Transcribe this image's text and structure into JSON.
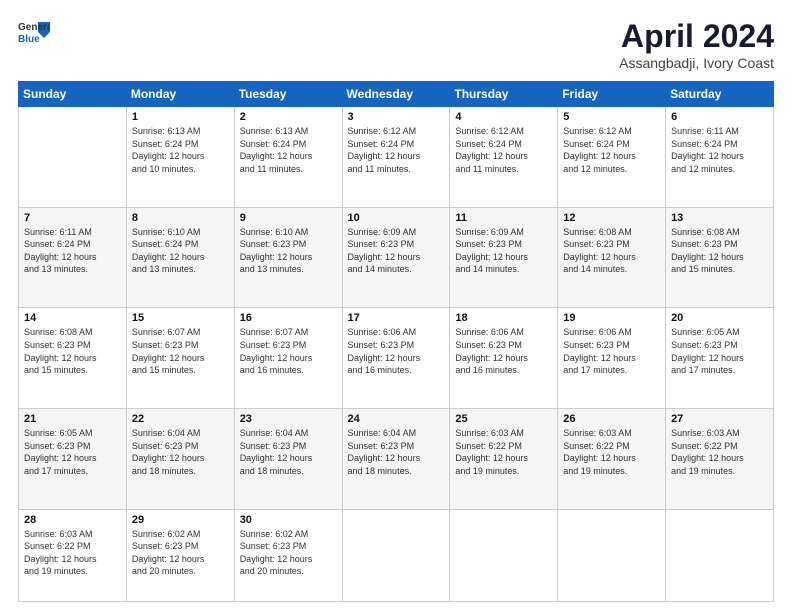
{
  "header": {
    "logo_general": "General",
    "logo_blue": "Blue",
    "month_title": "April 2024",
    "location": "Assangbadji, Ivory Coast"
  },
  "weekdays": [
    "Sunday",
    "Monday",
    "Tuesday",
    "Wednesday",
    "Thursday",
    "Friday",
    "Saturday"
  ],
  "weeks": [
    [
      {
        "day": "",
        "info": ""
      },
      {
        "day": "1",
        "info": "Sunrise: 6:13 AM\nSunset: 6:24 PM\nDaylight: 12 hours\nand 10 minutes."
      },
      {
        "day": "2",
        "info": "Sunrise: 6:13 AM\nSunset: 6:24 PM\nDaylight: 12 hours\nand 11 minutes."
      },
      {
        "day": "3",
        "info": "Sunrise: 6:12 AM\nSunset: 6:24 PM\nDaylight: 12 hours\nand 11 minutes."
      },
      {
        "day": "4",
        "info": "Sunrise: 6:12 AM\nSunset: 6:24 PM\nDaylight: 12 hours\nand 11 minutes."
      },
      {
        "day": "5",
        "info": "Sunrise: 6:12 AM\nSunset: 6:24 PM\nDaylight: 12 hours\nand 12 minutes."
      },
      {
        "day": "6",
        "info": "Sunrise: 6:11 AM\nSunset: 6:24 PM\nDaylight: 12 hours\nand 12 minutes."
      }
    ],
    [
      {
        "day": "7",
        "info": "Sunrise: 6:11 AM\nSunset: 6:24 PM\nDaylight: 12 hours\nand 13 minutes."
      },
      {
        "day": "8",
        "info": "Sunrise: 6:10 AM\nSunset: 6:24 PM\nDaylight: 12 hours\nand 13 minutes."
      },
      {
        "day": "9",
        "info": "Sunrise: 6:10 AM\nSunset: 6:23 PM\nDaylight: 12 hours\nand 13 minutes."
      },
      {
        "day": "10",
        "info": "Sunrise: 6:09 AM\nSunset: 6:23 PM\nDaylight: 12 hours\nand 14 minutes."
      },
      {
        "day": "11",
        "info": "Sunrise: 6:09 AM\nSunset: 6:23 PM\nDaylight: 12 hours\nand 14 minutes."
      },
      {
        "day": "12",
        "info": "Sunrise: 6:08 AM\nSunset: 6:23 PM\nDaylight: 12 hours\nand 14 minutes."
      },
      {
        "day": "13",
        "info": "Sunrise: 6:08 AM\nSunset: 6:23 PM\nDaylight: 12 hours\nand 15 minutes."
      }
    ],
    [
      {
        "day": "14",
        "info": "Sunrise: 6:08 AM\nSunset: 6:23 PM\nDaylight: 12 hours\nand 15 minutes."
      },
      {
        "day": "15",
        "info": "Sunrise: 6:07 AM\nSunset: 6:23 PM\nDaylight: 12 hours\nand 15 minutes."
      },
      {
        "day": "16",
        "info": "Sunrise: 6:07 AM\nSunset: 6:23 PM\nDaylight: 12 hours\nand 16 minutes."
      },
      {
        "day": "17",
        "info": "Sunrise: 6:06 AM\nSunset: 6:23 PM\nDaylight: 12 hours\nand 16 minutes."
      },
      {
        "day": "18",
        "info": "Sunrise: 6:06 AM\nSunset: 6:23 PM\nDaylight: 12 hours\nand 16 minutes."
      },
      {
        "day": "19",
        "info": "Sunrise: 6:06 AM\nSunset: 6:23 PM\nDaylight: 12 hours\nand 17 minutes."
      },
      {
        "day": "20",
        "info": "Sunrise: 6:05 AM\nSunset: 6:23 PM\nDaylight: 12 hours\nand 17 minutes."
      }
    ],
    [
      {
        "day": "21",
        "info": "Sunrise: 6:05 AM\nSunset: 6:23 PM\nDaylight: 12 hours\nand 17 minutes."
      },
      {
        "day": "22",
        "info": "Sunrise: 6:04 AM\nSunset: 6:23 PM\nDaylight: 12 hours\nand 18 minutes."
      },
      {
        "day": "23",
        "info": "Sunrise: 6:04 AM\nSunset: 6:23 PM\nDaylight: 12 hours\nand 18 minutes."
      },
      {
        "day": "24",
        "info": "Sunrise: 6:04 AM\nSunset: 6:23 PM\nDaylight: 12 hours\nand 18 minutes."
      },
      {
        "day": "25",
        "info": "Sunrise: 6:03 AM\nSunset: 6:22 PM\nDaylight: 12 hours\nand 19 minutes."
      },
      {
        "day": "26",
        "info": "Sunrise: 6:03 AM\nSunset: 6:22 PM\nDaylight: 12 hours\nand 19 minutes."
      },
      {
        "day": "27",
        "info": "Sunrise: 6:03 AM\nSunset: 6:22 PM\nDaylight: 12 hours\nand 19 minutes."
      }
    ],
    [
      {
        "day": "28",
        "info": "Sunrise: 6:03 AM\nSunset: 6:22 PM\nDaylight: 12 hours\nand 19 minutes."
      },
      {
        "day": "29",
        "info": "Sunrise: 6:02 AM\nSunset: 6:23 PM\nDaylight: 12 hours\nand 20 minutes."
      },
      {
        "day": "30",
        "info": "Sunrise: 6:02 AM\nSunset: 6:23 PM\nDaylight: 12 hours\nand 20 minutes."
      },
      {
        "day": "",
        "info": ""
      },
      {
        "day": "",
        "info": ""
      },
      {
        "day": "",
        "info": ""
      },
      {
        "day": "",
        "info": ""
      }
    ]
  ]
}
